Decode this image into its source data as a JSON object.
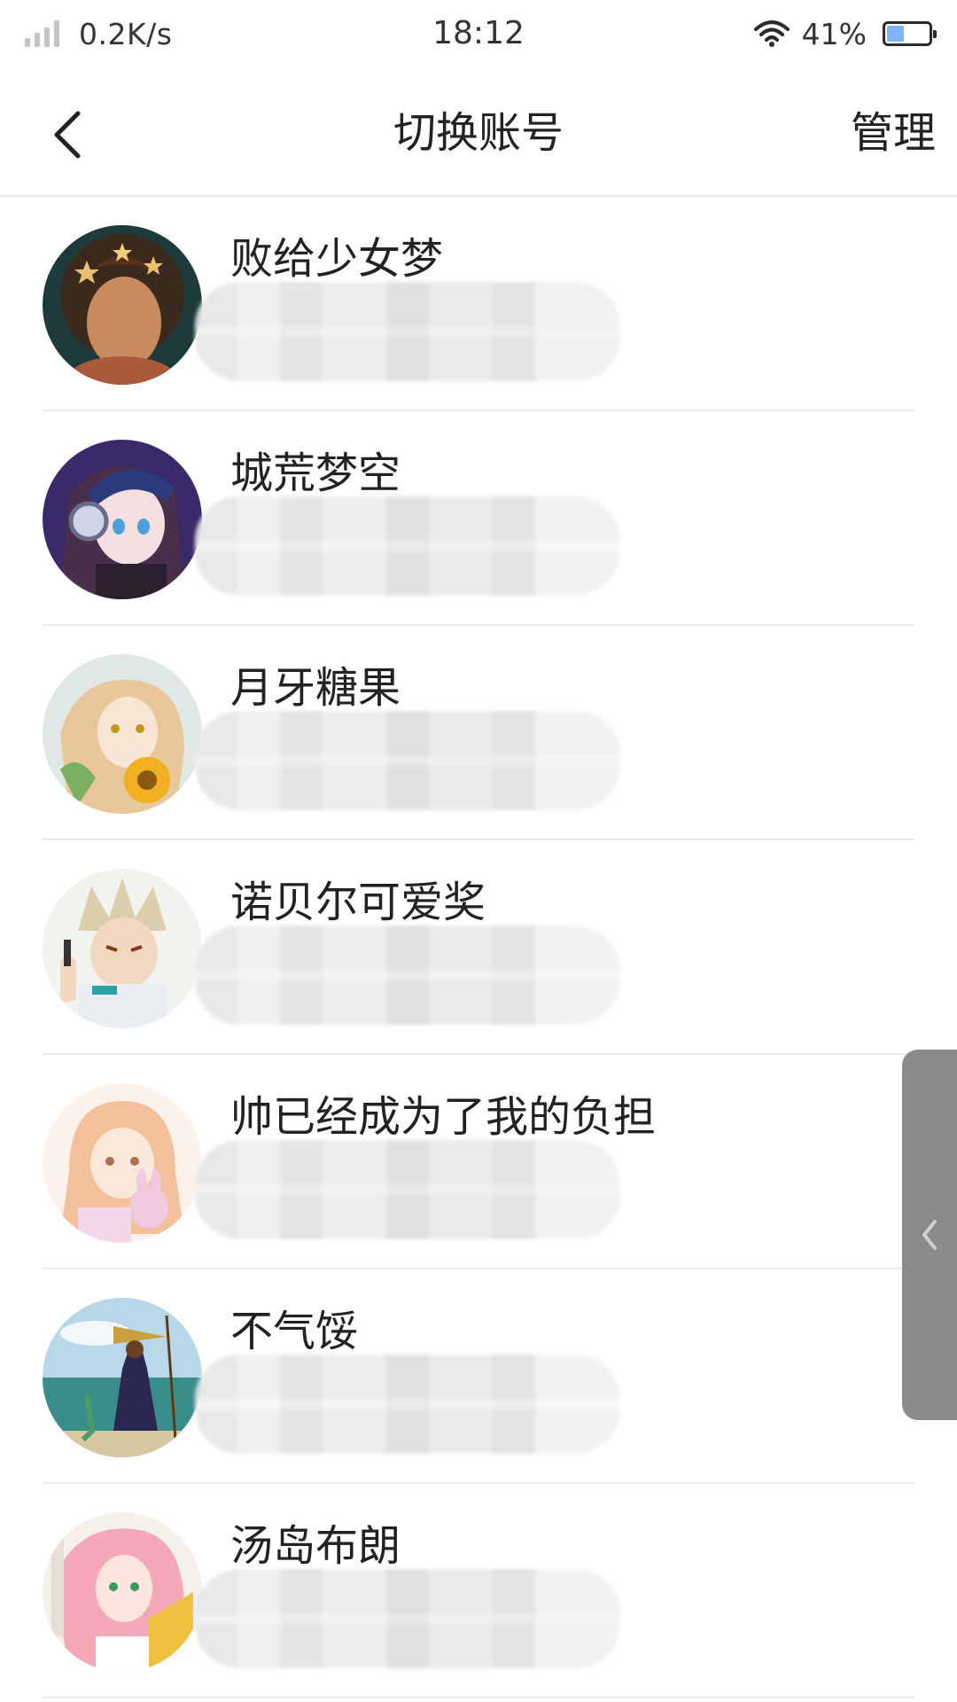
{
  "status_bar": {
    "net_speed": "0.2K/s",
    "time": "18:12",
    "battery_percent": "41%",
    "battery_level": 0.41,
    "icons": [
      "signal-icon",
      "wifi-icon",
      "battery-icon"
    ]
  },
  "header": {
    "back_icon": "chevron-left-icon",
    "title": "切换账号",
    "manage_label": "管理"
  },
  "accounts": [
    {
      "name": "败给少女梦",
      "avatar": "avatar-starry-girl"
    },
    {
      "name": "城荒梦空",
      "avatar": "avatar-anime-headphones"
    },
    {
      "name": "月牙糖果",
      "avatar": "avatar-sunflower-girl"
    },
    {
      "name": "诺贝尔可爱奖",
      "avatar": "avatar-anime-boy"
    },
    {
      "name": "帅已经成为了我的负担",
      "avatar": "avatar-pastel-girl"
    },
    {
      "name": "不气馁",
      "avatar": "avatar-beach-scene"
    },
    {
      "name": "汤岛布朗",
      "avatar": "avatar-pink-hair-girl"
    }
  ],
  "side_handle": {
    "icon": "chevron-left-icon"
  },
  "colors": {
    "background": "#ffffff",
    "text": "#222222",
    "divider": "#ececec",
    "side_handle": "#8a8a8a"
  }
}
